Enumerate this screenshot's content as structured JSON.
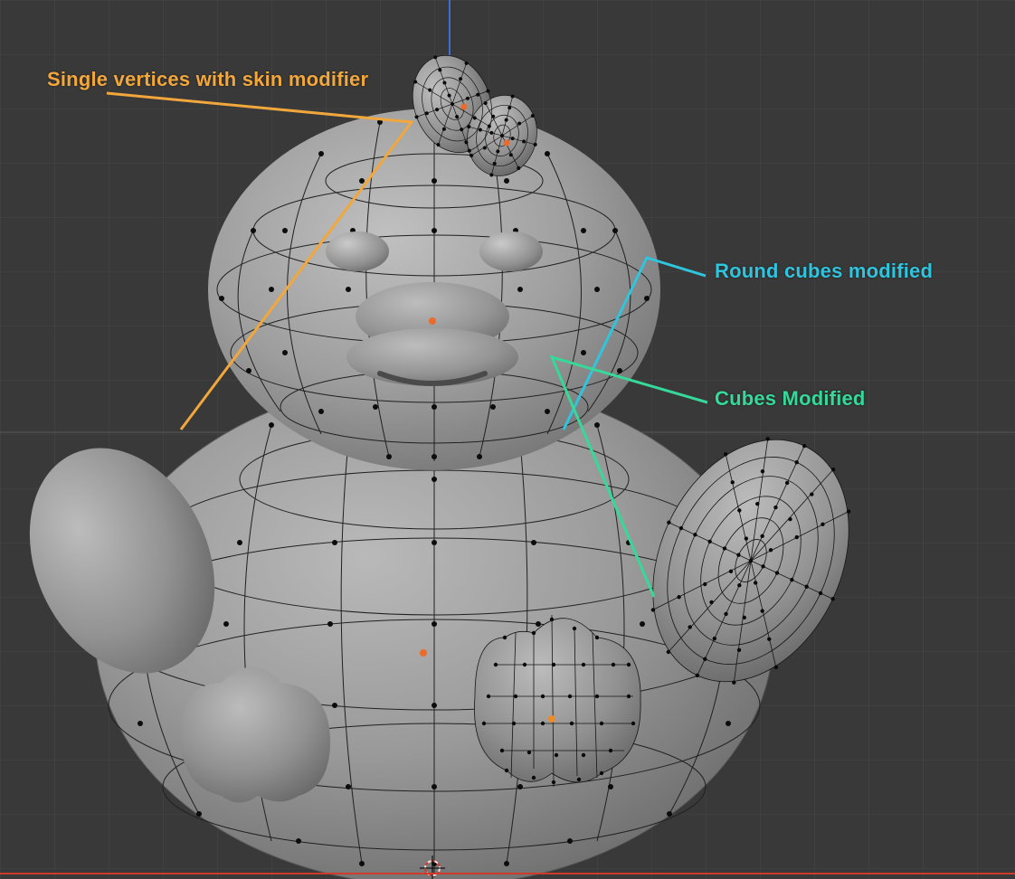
{
  "viewport": {
    "background_color": "#393939",
    "grid_minor_color": "#464646",
    "grid_major_color": "#4f4f4f",
    "axis_z_color": "#3b6fd1",
    "red_line_color": "#cf3a2b",
    "cursor_visible": true
  },
  "annotations": {
    "skin": {
      "label": "Single vertices with skin modifier",
      "color": "#f2a73d"
    },
    "roundcubes": {
      "label": "Round cubes modified",
      "color": "#2fc5df"
    },
    "cubes": {
      "label": "Cubes Modified",
      "color": "#35d99a"
    }
  }
}
